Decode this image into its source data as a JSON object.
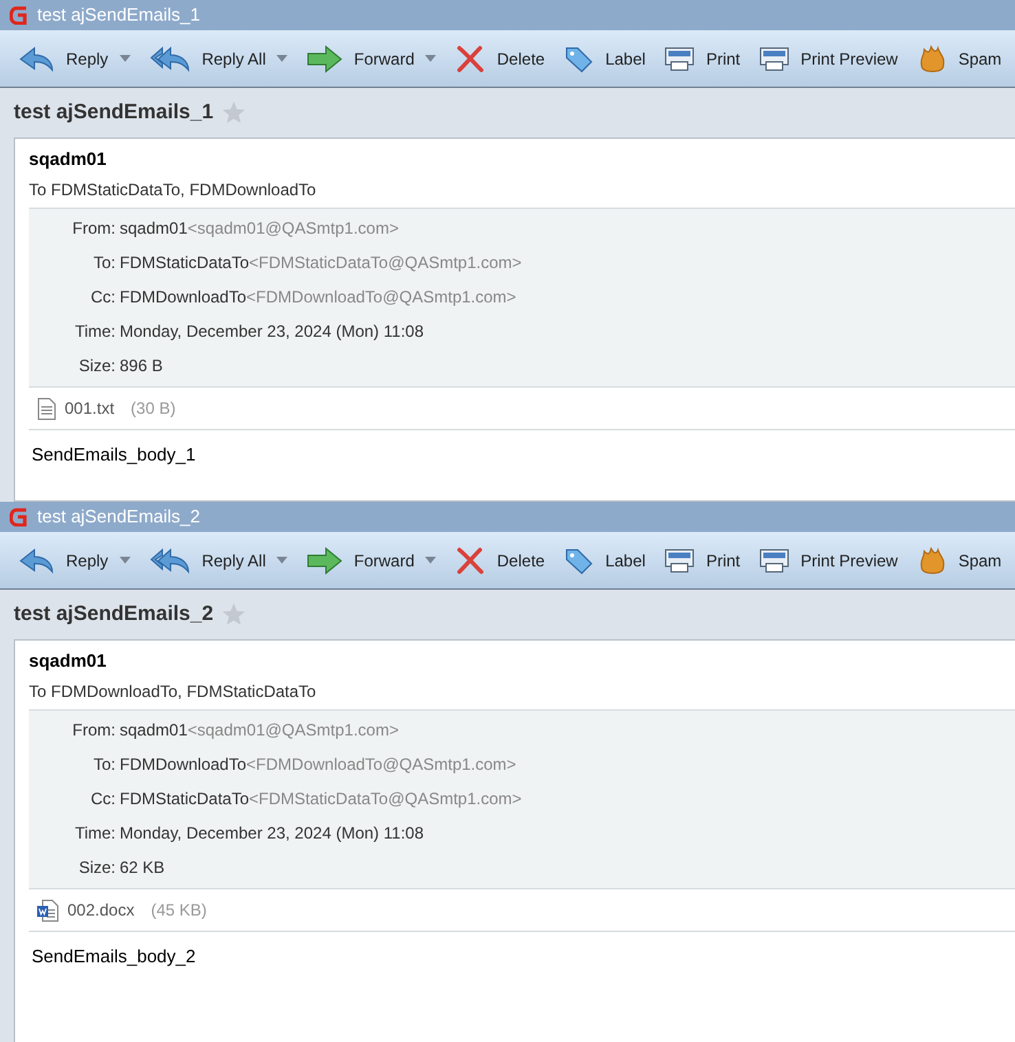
{
  "windows": [
    {
      "title": "test ajSendEmails_1",
      "toolbar": [
        {
          "kind": "reply",
          "label": "Reply",
          "dropdown": true
        },
        {
          "kind": "reply-all",
          "label": "Reply All",
          "dropdown": true
        },
        {
          "kind": "forward",
          "label": "Forward",
          "dropdown": true
        },
        {
          "kind": "delete",
          "label": "Delete",
          "dropdown": false
        },
        {
          "kind": "label",
          "label": "Label",
          "dropdown": false
        },
        {
          "kind": "print",
          "label": "Print",
          "dropdown": false
        },
        {
          "kind": "print-preview",
          "label": "Print Preview",
          "dropdown": false
        },
        {
          "kind": "spam",
          "label": "Spam",
          "dropdown": false
        }
      ],
      "subject": "test ajSendEmails_1",
      "starred": false,
      "sender": "sqadm01",
      "recipients": "To FDMStaticDataTo, FDMDownloadTo",
      "headers": [
        {
          "label": "From:",
          "name": "sqadm01",
          "address": "<sqadm01@QASmtp1.com>"
        },
        {
          "label": "To:",
          "name": "FDMStaticDataTo",
          "address": "<FDMStaticDataTo@QASmtp1.com>"
        },
        {
          "label": "Cc:",
          "name": "FDMDownloadTo",
          "address": "<FDMDownloadTo@QASmtp1.com>"
        },
        {
          "label": "Time:",
          "name": "Monday, December 23, 2024 (Mon) 11:08"
        },
        {
          "label": "Size:",
          "name": "896 B"
        }
      ],
      "attachment": {
        "kind": "text",
        "name": "001.txt",
        "size": "(30 B)"
      },
      "body": "SendEmails_body_1"
    },
    {
      "title": "test ajSendEmails_2",
      "toolbar": [
        {
          "kind": "reply",
          "label": "Reply",
          "dropdown": true
        },
        {
          "kind": "reply-all",
          "label": "Reply All",
          "dropdown": true
        },
        {
          "kind": "forward",
          "label": "Forward",
          "dropdown": true
        },
        {
          "kind": "delete",
          "label": "Delete",
          "dropdown": false
        },
        {
          "kind": "label",
          "label": "Label",
          "dropdown": false
        },
        {
          "kind": "print",
          "label": "Print",
          "dropdown": false
        },
        {
          "kind": "print-preview",
          "label": "Print Preview",
          "dropdown": false
        },
        {
          "kind": "spam",
          "label": "Spam",
          "dropdown": false
        }
      ],
      "subject": "test ajSendEmails_2",
      "starred": false,
      "sender": "sqadm01",
      "recipients": "To FDMDownloadTo, FDMStaticDataTo",
      "headers": [
        {
          "label": "From:",
          "name": "sqadm01",
          "address": "<sqadm01@QASmtp1.com>"
        },
        {
          "label": "To:",
          "name": "FDMDownloadTo",
          "address": "<FDMDownloadTo@QASmtp1.com>"
        },
        {
          "label": "Cc:",
          "name": "FDMStaticDataTo",
          "address": "<FDMStaticDataTo@QASmtp1.com>"
        },
        {
          "label": "Time:",
          "name": "Monday, December 23, 2024 (Mon) 11:08"
        },
        {
          "label": "Size:",
          "name": "62 KB"
        }
      ],
      "attachment": {
        "kind": "word",
        "name": "002.docx",
        "size": "(45 KB)"
      },
      "body": "SendEmails_body_2"
    }
  ]
}
